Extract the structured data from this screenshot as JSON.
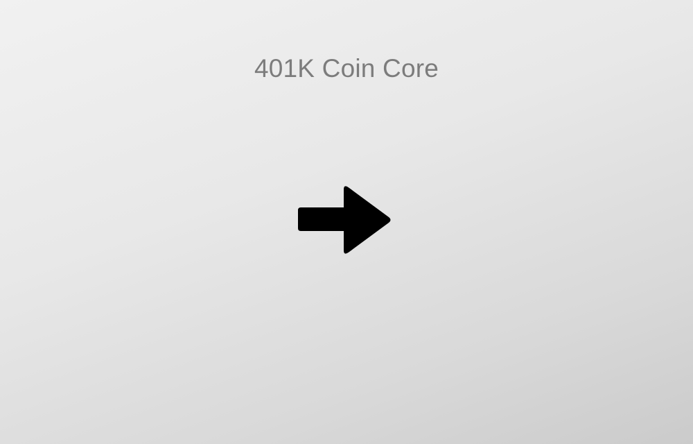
{
  "splash": {
    "title": "401K Coin Core",
    "background_colors": [
      "#f1f1f1",
      "#cbcbcb"
    ],
    "title_color": "#7c7c7c",
    "continue_icon": "arrow-right-icon",
    "icon_color": "#000000"
  }
}
